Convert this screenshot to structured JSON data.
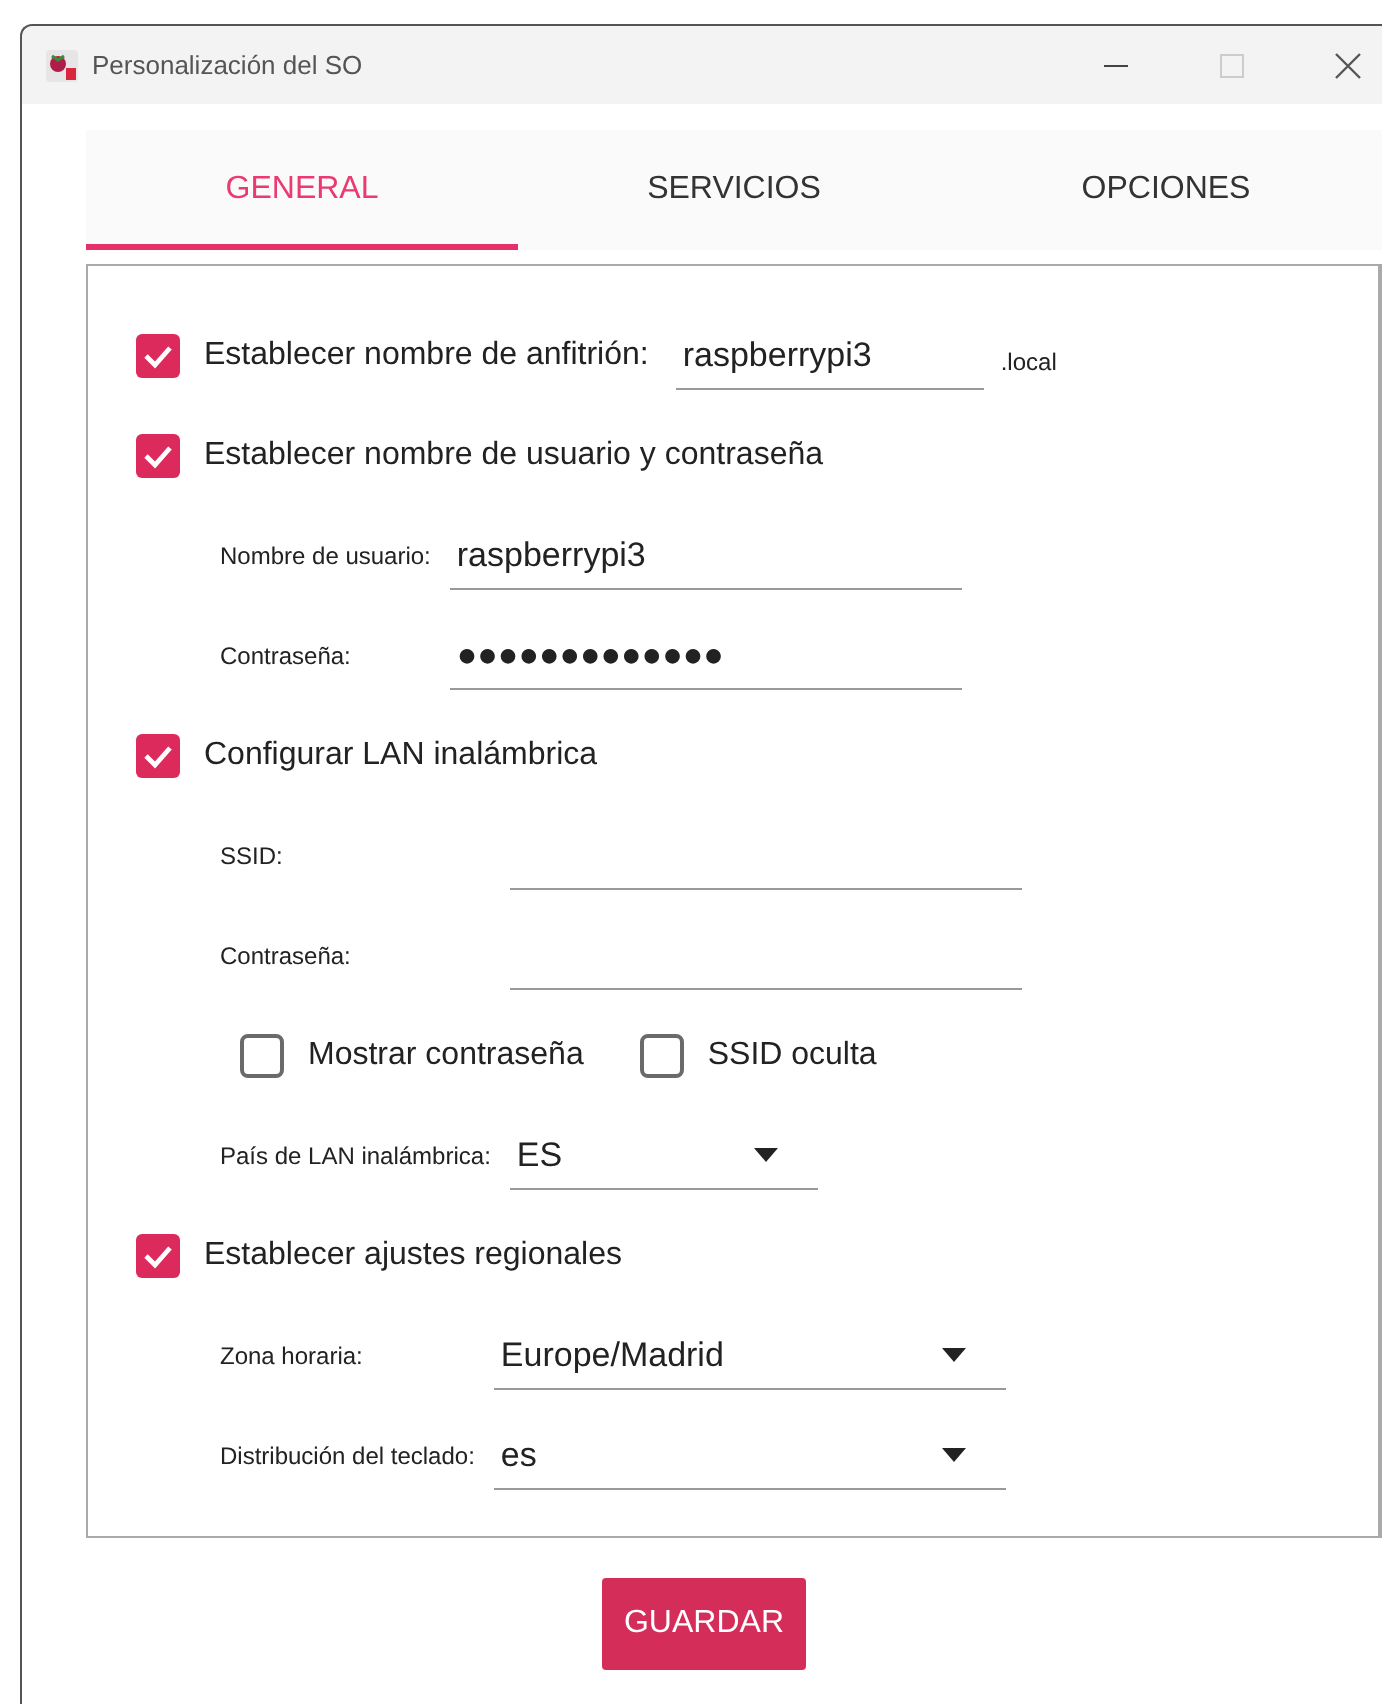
{
  "window": {
    "title": "Personalización del SO"
  },
  "tabs": [
    {
      "label": "GENERAL",
      "selected": true
    },
    {
      "label": "SERVICIOS",
      "selected": false
    },
    {
      "label": "OPCIONES",
      "selected": false
    }
  ],
  "sections": [
    {
      "label": "Establecer nombre de anfitrión:",
      "checked": true,
      "value": "raspberrypi3",
      "suffix": ".local"
    },
    {
      "label": "Establecer nombre de usuario y contraseña",
      "checked": true,
      "rows": [
        {
          "kind": "field",
          "label": "Nombre de usuario:",
          "value": "raspberrypi3"
        },
        {
          "kind": "field",
          "label": "Contraseña:",
          "value": "●●●●●●●●●●●●●"
        }
      ]
    },
    {
      "label": "Configurar LAN inalámbrica",
      "checked": true,
      "rows": [
        {
          "kind": "field",
          "label": "SSID:"
        },
        {
          "kind": "field",
          "label": "Contraseña:"
        },
        {
          "kind": "checks",
          "options": [
            {
              "label": "Mostrar contraseña",
              "checked": false
            },
            {
              "label": "SSID oculta",
              "checked": false
            }
          ]
        },
        {
          "kind": "select",
          "label": "País de LAN inalámbrica:",
          "value": "ES"
        }
      ]
    },
    {
      "label": "Establecer ajustes regionales",
      "checked": true,
      "rows": [
        {
          "kind": "select",
          "label": "Zona horaria:",
          "value": "Europe/Madrid"
        },
        {
          "kind": "select",
          "label": "Distribución del teclado:",
          "value": "es"
        }
      ]
    }
  ],
  "save_button": "GUARDAR"
}
